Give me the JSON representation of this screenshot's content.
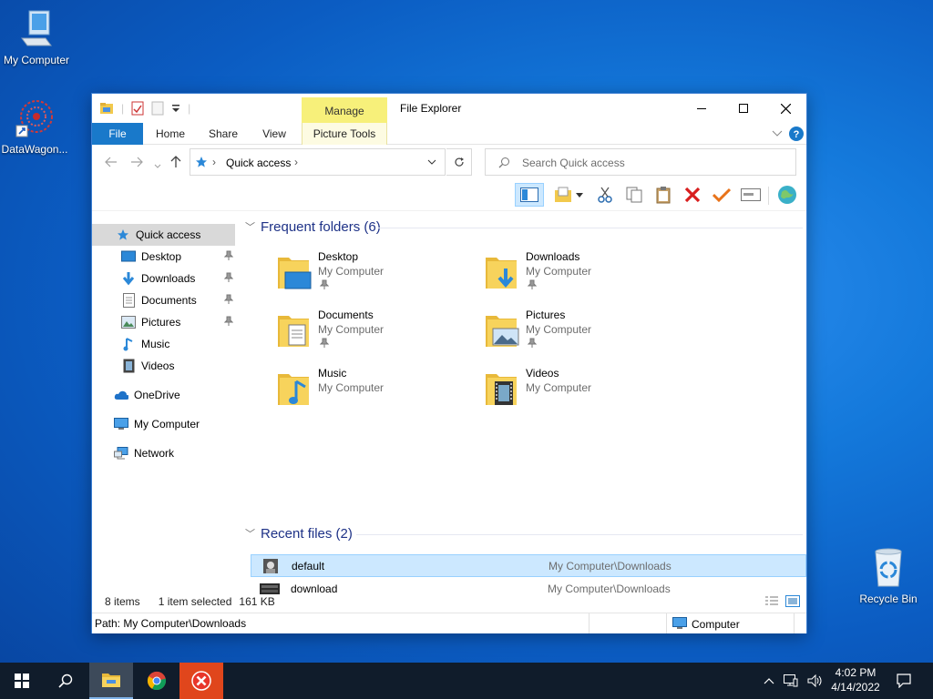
{
  "desktop": {
    "icons": [
      {
        "label": "My Computer"
      },
      {
        "label": "DataWagon..."
      },
      {
        "label": "Recycle Bin"
      }
    ]
  },
  "window": {
    "title": "File Explorer",
    "contextual_tab": "Manage",
    "tabs": [
      {
        "label": "File"
      },
      {
        "label": "Home"
      },
      {
        "label": "Share"
      },
      {
        "label": "View"
      },
      {
        "label": "Picture Tools"
      }
    ]
  },
  "address": {
    "path": "Quick access",
    "search_placeholder": "Search Quick access"
  },
  "nav": {
    "items": [
      {
        "label": "Quick access",
        "icon": "star-icon"
      },
      {
        "label": "Desktop",
        "icon": "desktop-icon",
        "pinned": true
      },
      {
        "label": "Downloads",
        "icon": "download-arrow-icon",
        "pinned": true
      },
      {
        "label": "Documents",
        "icon": "document-icon",
        "pinned": true
      },
      {
        "label": "Pictures",
        "icon": "picture-icon",
        "pinned": true
      },
      {
        "label": "Music",
        "icon": "music-note-icon"
      },
      {
        "label": "Videos",
        "icon": "film-icon"
      },
      {
        "label": "OneDrive",
        "icon": "cloud-icon"
      },
      {
        "label": "My Computer",
        "icon": "computer-icon"
      },
      {
        "label": "Network",
        "icon": "network-icon"
      }
    ]
  },
  "frequent": {
    "header": "Frequent folders (6)",
    "folders": [
      {
        "name": "Desktop",
        "location": "My Computer",
        "pinned": true
      },
      {
        "name": "Downloads",
        "location": "My Computer",
        "pinned": true
      },
      {
        "name": "Documents",
        "location": "My Computer",
        "pinned": true
      },
      {
        "name": "Pictures",
        "location": "My Computer",
        "pinned": true
      },
      {
        "name": "Music",
        "location": "My Computer"
      },
      {
        "name": "Videos",
        "location": "My Computer"
      }
    ]
  },
  "recent": {
    "header": "Recent files (2)",
    "files": [
      {
        "name": "default",
        "path": "My Computer\\Downloads",
        "selected": true
      },
      {
        "name": "download",
        "path": "My Computer\\Downloads"
      }
    ]
  },
  "status": {
    "items_count": "8 items",
    "selection": "1 item selected",
    "size": "161 KB"
  },
  "pathbar": {
    "path": "Path: My Computer\\Downloads",
    "zone": "Computer"
  },
  "taskbar": {
    "time": "4:02 PM",
    "date": "4/14/2022"
  },
  "colors": {
    "accent": "#1979ca",
    "selection": "#cce8ff",
    "manage_tab": "#f7f07a",
    "folder": "#f2c94c"
  }
}
